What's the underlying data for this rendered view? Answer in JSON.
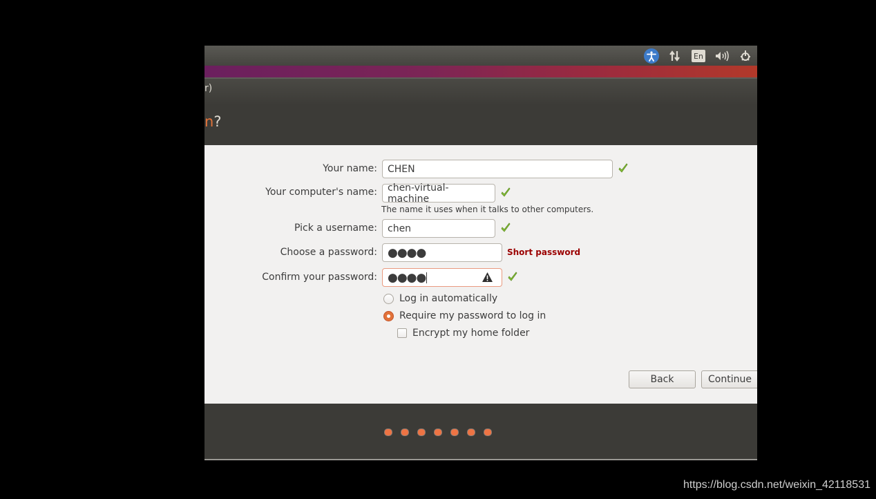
{
  "topbar": {
    "indicators": [
      {
        "name": "accessibility-icon"
      },
      {
        "name": "network-icon",
        "glyph": "⇅"
      },
      {
        "name": "keyboard-layout-icon",
        "label": "En"
      },
      {
        "name": "volume-icon",
        "glyph": "🔊"
      },
      {
        "name": "power-icon",
        "glyph": "⚙"
      }
    ],
    "keyboard_label": "En"
  },
  "header": {
    "title_fragment": "r)",
    "question_fragment": "n",
    "question_mark": "?"
  },
  "form": {
    "your_name": {
      "label": "Your name:",
      "value": "CHEN",
      "valid": true
    },
    "computer_name": {
      "label": "Your computer's name:",
      "value": "chen-virtual-machine",
      "valid": true,
      "hint": "The name it uses when it talks to other computers."
    },
    "username": {
      "label": "Pick a username:",
      "value": "chen",
      "valid": true
    },
    "password": {
      "label": "Choose a password:",
      "masked_value": "●●●●",
      "strength": "Short password"
    },
    "confirm_password": {
      "label": "Confirm your password:",
      "masked_value": "●●●●",
      "valid": true,
      "warning_icon": "warning-icon"
    },
    "login_options": [
      {
        "label": "Log in automatically",
        "selected": false
      },
      {
        "label": "Require my password to log in",
        "selected": true
      }
    ],
    "encrypt_home": {
      "label": "Encrypt my home folder",
      "checked": false
    }
  },
  "buttons": {
    "back": "Back",
    "continue": "Continue"
  },
  "progress": {
    "total_steps": 7
  },
  "colors": {
    "accent": "#e2733a",
    "valid_check": "#8ac53a",
    "error_text": "#9b0000",
    "dialog_bg": "#f2f1f0",
    "chrome_bg": "#3c3b37"
  },
  "watermark": "https://blog.csdn.net/weixin_42118531"
}
